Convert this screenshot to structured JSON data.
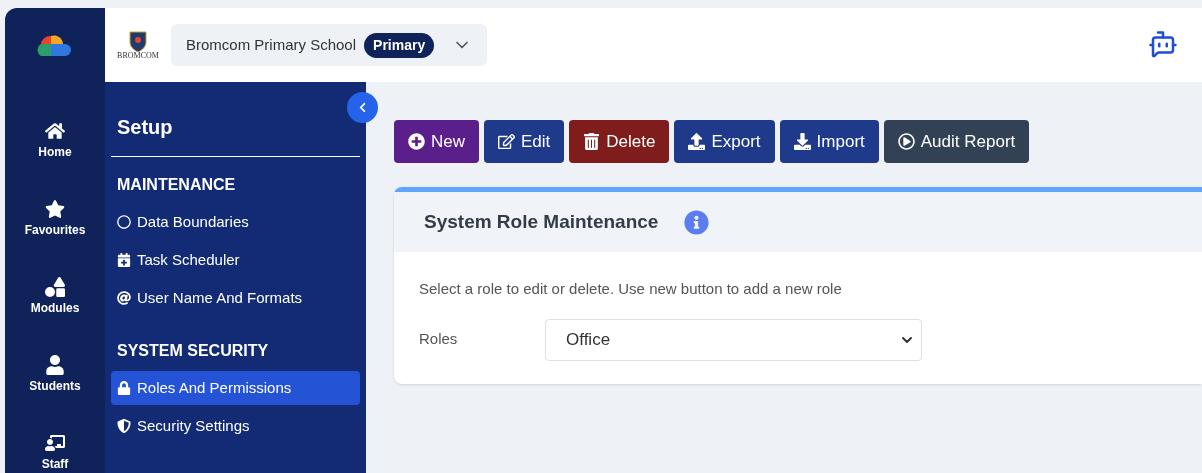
{
  "header": {
    "logo_text": "BROMCOM",
    "school": "Bromcom Primary School",
    "school_badge": "Primary"
  },
  "rail": [
    {
      "kind": "home",
      "label": "Home"
    },
    {
      "kind": "favourites",
      "label": "Favourites"
    },
    {
      "kind": "modules",
      "label": "Modules"
    },
    {
      "kind": "students",
      "label": "Students"
    },
    {
      "kind": "staff",
      "label": "Staff"
    }
  ],
  "sidebar": {
    "title": "Setup",
    "sections": [
      {
        "heading": "MAINTENANCE",
        "items": [
          {
            "kind": "circle",
            "label": "Data Boundaries",
            "selected": false
          },
          {
            "kind": "calendar",
            "label": "Task Scheduler",
            "selected": false
          },
          {
            "kind": "at",
            "label": "User Name And Formats",
            "selected": false
          }
        ]
      },
      {
        "heading": "SYSTEM SECURITY",
        "items": [
          {
            "kind": "lock",
            "label": "Roles And Permissions",
            "selected": true
          },
          {
            "kind": "shield",
            "label": "Security Settings",
            "selected": false
          }
        ]
      }
    ]
  },
  "toolbar": [
    {
      "kind": "new",
      "label": "New"
    },
    {
      "kind": "edit",
      "label": "Edit"
    },
    {
      "kind": "delete",
      "label": "Delete"
    },
    {
      "kind": "export",
      "label": "Export"
    },
    {
      "kind": "import",
      "label": "Import"
    },
    {
      "kind": "audit",
      "label": "Audit Report"
    }
  ],
  "panel": {
    "title": "System Role Maintenance",
    "instructions": "Select a role to edit or delete. Use new button to add a new role",
    "field_label": "Roles",
    "field_value": "Office"
  }
}
